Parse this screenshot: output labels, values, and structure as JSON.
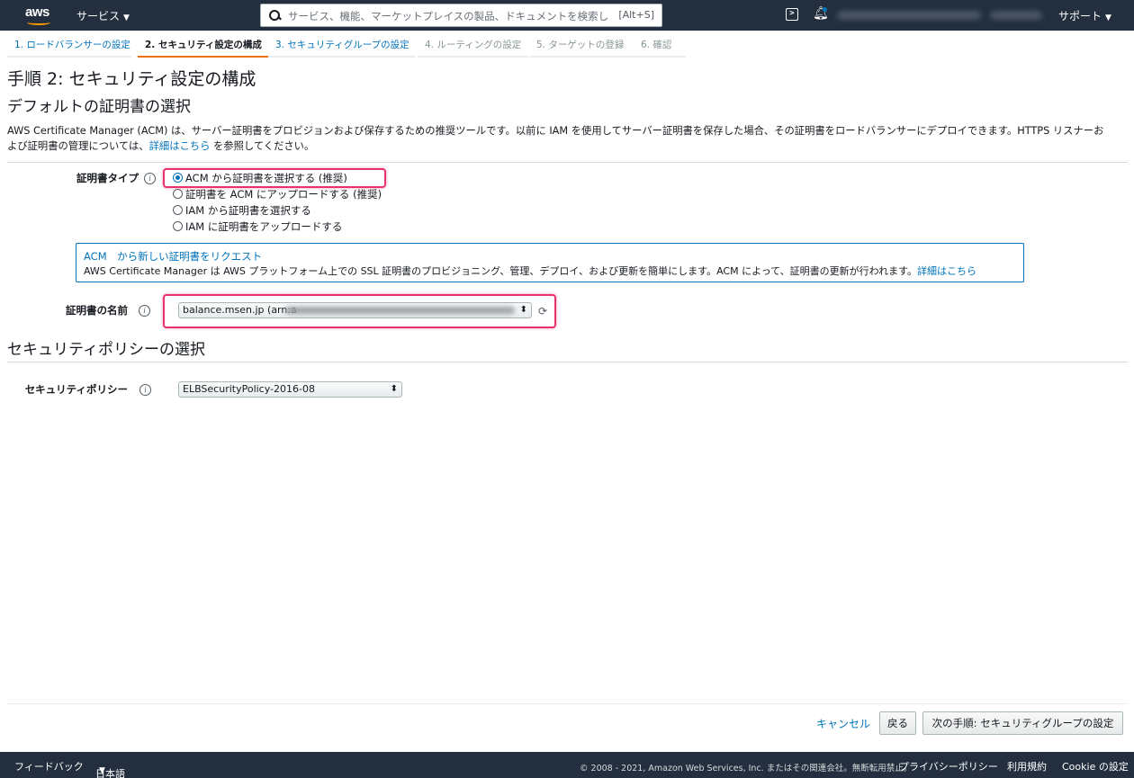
{
  "topnav": {
    "logo": "aws",
    "services": "サービス",
    "search_placeholder": "サービス、機能、マーケットプレイスの製品、ドキュメントを検索し",
    "search_shortcut": "[Alt+S]",
    "support": "サポート"
  },
  "steps": [
    {
      "label": "1. ロードバランサーの設定"
    },
    {
      "label": "2. セキュリティ設定の構成"
    },
    {
      "label": "3. セキュリティグループの設定"
    },
    {
      "label": "4. ルーティングの設定"
    },
    {
      "label": "5. ターゲットの登録"
    },
    {
      "label": "6. 確認"
    }
  ],
  "page_title": "手順 2: セキュリティ設定の構成",
  "cert_section": {
    "title": "デフォルトの証明書の選択",
    "desc_1": "AWS Certificate Manager (ACM) は、サーバー証明書をプロビジョンおよび保存するための推奨ツールです。以前に IAM を使用してサーバー証明書を保存した場合、その証明書をロードバランサーにデプロイできます。HTTPS リスナーお",
    "desc_2a": "よび証明書の管理については、",
    "desc_link": "詳細はこちら",
    "desc_2b": " を参照してください。",
    "type_label": "証明書タイプ",
    "type_options": [
      "ACM から証明書を選択する (推奨)",
      "証明書を ACM にアップロードする (推奨)",
      "IAM から証明書を選択する",
      "IAM に証明書をアップロードする"
    ],
    "info_title": "ACM　から新しい証明書をリクエスト",
    "info_body": "AWS Certificate Manager は AWS プラットフォーム上での SSL 証明書のプロビジョニング、管理、デプロイ、および更新を簡単にします。ACM によって、証明書の更新が行われます。",
    "info_link": "詳細はこちら",
    "name_label": "証明書の名前",
    "name_value": "balance.msen.jp (arn:a"
  },
  "policy_section": {
    "title": "セキュリティポリシーの選択",
    "label": "セキュリティポリシー",
    "value": "ELBSecurityPolicy-2016-08"
  },
  "actions": {
    "cancel": "キャンセル",
    "back": "戻る",
    "next": "次の手順: セキュリティグループの設定"
  },
  "bottombar": {
    "feedback": "フィードバック",
    "language": "日本語",
    "copyright": "© 2008 - 2021, Amazon Web Services, Inc. またはその関連会社。無断転用禁止。",
    "privacy": "プライバシーポリシー",
    "terms": "利用規約",
    "cookie": "Cookie の設定"
  },
  "colors": {
    "nav_bg": "#232f3e",
    "link": "#0073bb",
    "active_step": "#ec7211",
    "highlight": "#e8336a"
  }
}
